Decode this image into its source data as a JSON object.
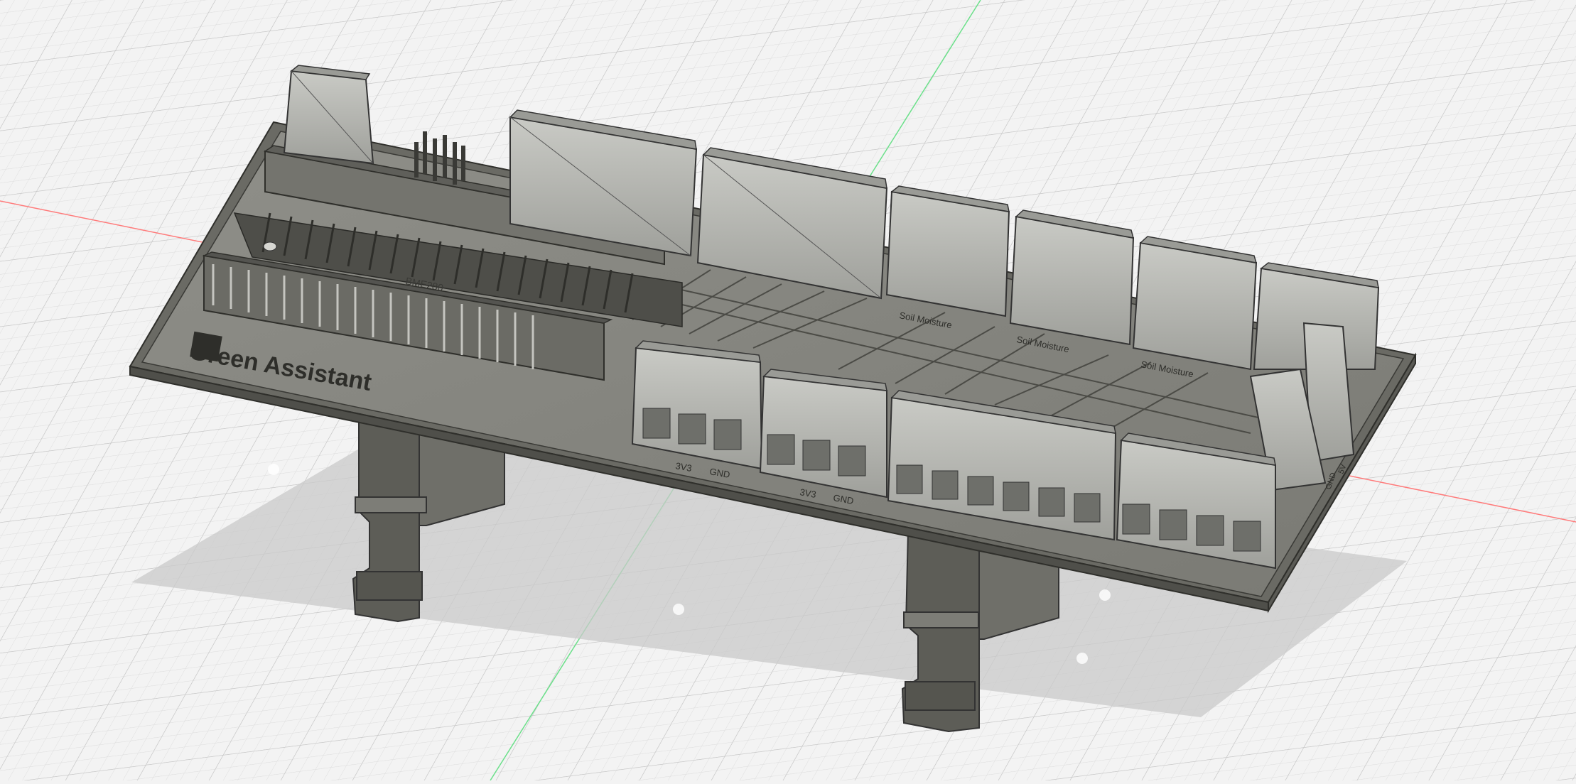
{
  "viewport": {
    "background": "#f3f3f3",
    "grid_minor_color": "#dcdcdc",
    "grid_major_color": "#c4c4c4",
    "x_axis_color": "#ff6b6b",
    "y_axis_color": "#5ee07a"
  },
  "model": {
    "body_color": "#8a8a84",
    "body_dark": "#55554f",
    "terminal_color": "#b6b7b2",
    "engraving": {
      "logo_text": "Green Assistant",
      "header_label": "BME280",
      "power_label_1_a": "3V3",
      "power_label_1_b": "GND",
      "power_label_2_a": "3V3",
      "power_label_2_b": "GND",
      "sensor_label_1": "Soil Moisture",
      "sensor_label_2": "Soil Moisture",
      "sensor_label_3": "Soil Moisture",
      "edge_label_a": "5V",
      "edge_label_b": "GND"
    }
  }
}
